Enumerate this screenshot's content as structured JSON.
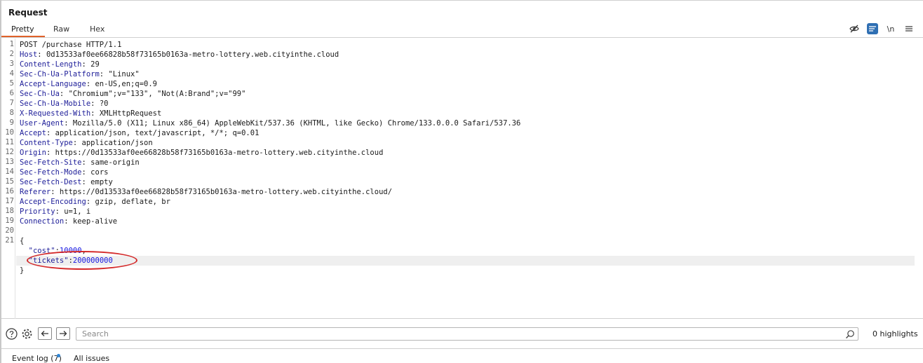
{
  "panel": {
    "title": "Request"
  },
  "tabs": [
    {
      "label": "Pretty",
      "active": true
    },
    {
      "label": "Raw",
      "active": false
    },
    {
      "label": "Hex",
      "active": false
    }
  ],
  "toolbar": {
    "hide_icon": "eye-slash-icon",
    "wrap_icon": "wrap-lines-icon",
    "newline_label": "\\n",
    "menu_icon": "hamburger-menu-icon"
  },
  "editor": {
    "line_numbers": [
      "1",
      "2",
      "3",
      "4",
      "5",
      "6",
      "7",
      "8",
      "9",
      "10",
      "11",
      "12",
      "13",
      "14",
      "15",
      "16",
      "17",
      "18",
      "19",
      "20",
      "21"
    ],
    "request_line": "POST /purchase HTTP/1.1",
    "headers": [
      {
        "name": "Host",
        "value": "0d13533af0ee66828b58f73165b0163a-metro-lottery.web.cityinthe.cloud"
      },
      {
        "name": "Content-Length",
        "value": "29"
      },
      {
        "name": "Sec-Ch-Ua-Platform",
        "value": "\"Linux\""
      },
      {
        "name": "Accept-Language",
        "value": "en-US,en;q=0.9"
      },
      {
        "name": "Sec-Ch-Ua",
        "value": "\"Chromium\";v=\"133\", \"Not(A:Brand\";v=\"99\""
      },
      {
        "name": "Sec-Ch-Ua-Mobile",
        "value": "?0"
      },
      {
        "name": "X-Requested-With",
        "value": "XMLHttpRequest"
      },
      {
        "name": "User-Agent",
        "value": "Mozilla/5.0 (X11; Linux x86_64) AppleWebKit/537.36 (KHTML, like Gecko) Chrome/133.0.0.0 Safari/537.36"
      },
      {
        "name": "Accept",
        "value": "application/json, text/javascript, */*; q=0.01"
      },
      {
        "name": "Content-Type",
        "value": "application/json"
      },
      {
        "name": "Origin",
        "value": "https://0d13533af0ee66828b58f73165b0163a-metro-lottery.web.cityinthe.cloud"
      },
      {
        "name": "Sec-Fetch-Site",
        "value": "same-origin"
      },
      {
        "name": "Sec-Fetch-Mode",
        "value": "cors"
      },
      {
        "name": "Sec-Fetch-Dest",
        "value": "empty"
      },
      {
        "name": "Referer",
        "value": "https://0d13533af0ee66828b58f73165b0163a-metro-lottery.web.cityinthe.cloud/"
      },
      {
        "name": "Accept-Encoding",
        "value": "gzip, deflate, br"
      },
      {
        "name": "Priority",
        "value": "u=1, i"
      },
      {
        "name": "Connection",
        "value": "keep-alive"
      }
    ],
    "body": {
      "open_brace": "{",
      "cost_key": "\"cost\"",
      "cost_value": "10000",
      "tickets_key": "\"tickets\"",
      "tickets_value": "200000000",
      "close_brace": "}"
    }
  },
  "search": {
    "placeholder": "Search",
    "highlights": "0 highlights"
  },
  "status_bar": {
    "event_log": "Event log (7)",
    "all_issues": "All issues"
  },
  "colors": {
    "accent": "#e0622a",
    "annotation": "#d42a2a",
    "selected_button": "#2f6fb3"
  }
}
